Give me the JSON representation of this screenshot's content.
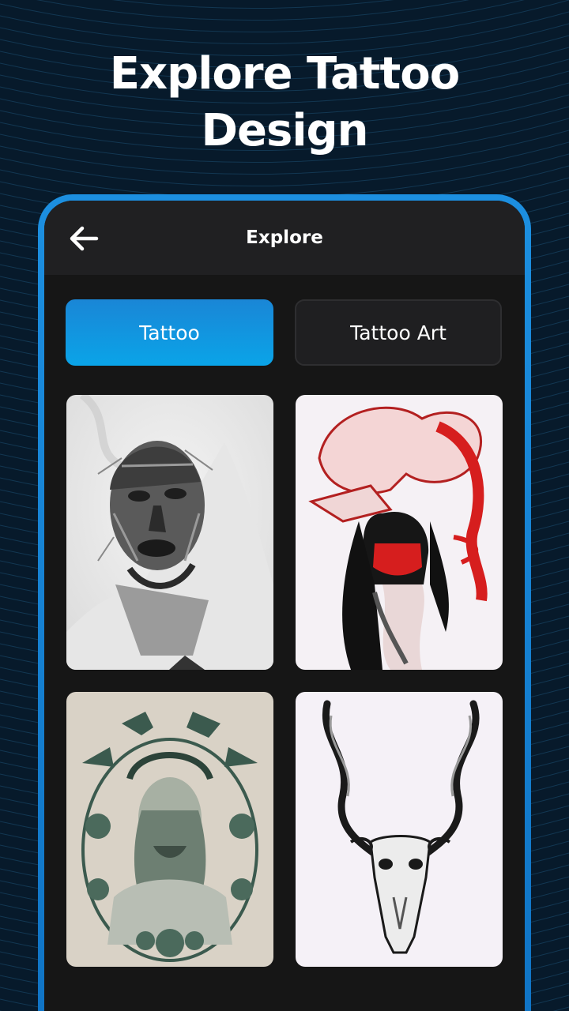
{
  "promo": {
    "title_line1": "Explore Tattoo",
    "title_line2": "Design"
  },
  "app_bar": {
    "back_icon": "arrow-left-icon",
    "title": "Explore"
  },
  "tabs": [
    {
      "label": "Tattoo",
      "active": true
    },
    {
      "label": "Tattoo Art",
      "active": false
    }
  ],
  "gallery": {
    "items": [
      {
        "subject": "realistic portrait sketch of a man"
      },
      {
        "subject": "dragon over masked woman, red ink"
      },
      {
        "subject": "crowned figure framed by swallows and roses"
      },
      {
        "subject": "horned animal skull"
      }
    ]
  },
  "colors": {
    "background": "#071a2b",
    "frame": "#1c8fe0",
    "screen": "#161616",
    "app_bar": "#202022",
    "active_tab": "#0aa4e8",
    "inactive_tab": "#1f1f21"
  }
}
